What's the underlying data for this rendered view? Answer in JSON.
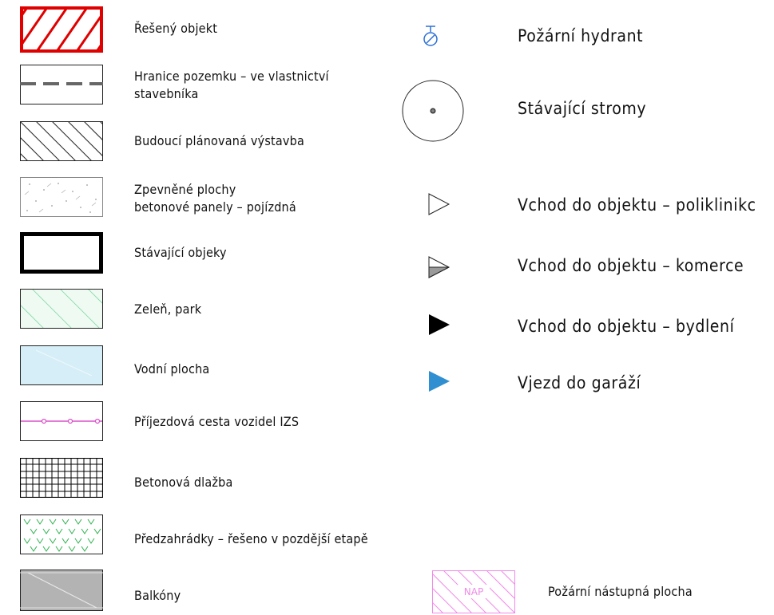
{
  "legend_left": [
    {
      "label": "Řešený objekt"
    },
    {
      "label": "Hranice pozemku – ve vlastnictví",
      "label2": "stavebníka"
    },
    {
      "label": "Budoucí plánovaná výstavba"
    },
    {
      "label": "Zpevněné plochy",
      "label2": "betonové panely – pojízdná"
    },
    {
      "label": "Stávající objeky"
    },
    {
      "label": "Zeleň, park"
    },
    {
      "label": "Vodní plocha"
    },
    {
      "label": "Příjezdová cesta vozidel IZS"
    },
    {
      "label": "Betonová dlažba"
    },
    {
      "label": "Předzahrádky – řešeno v pozdější etapě"
    },
    {
      "label": "Balkóny"
    }
  ],
  "legend_right": [
    {
      "label": "Požární hydrant"
    },
    {
      "label": "Stávající stromy"
    },
    {
      "label": "Vchod do objektu – poliklinikc"
    },
    {
      "label": "Vchod do objektu – komerce"
    },
    {
      "label": "Vchod do objektu – bydlení"
    },
    {
      "label": "Vjezd do garáží"
    },
    {
      "label": "Požární nástupná plocha",
      "swatch_text": "NAP"
    }
  ],
  "colors": {
    "solved_object": "#e00000",
    "green": "#5fd08a",
    "green_fill": "#eefaf2",
    "water_fill": "#d6eef7",
    "ifs_line": "#d850c8",
    "garden": "#2fb24f",
    "balcony_fill": "#b3b3b3",
    "hydrant": "#2a6fd6",
    "garage_entry": "#2f8fd0",
    "nap": "#f08ae8"
  }
}
